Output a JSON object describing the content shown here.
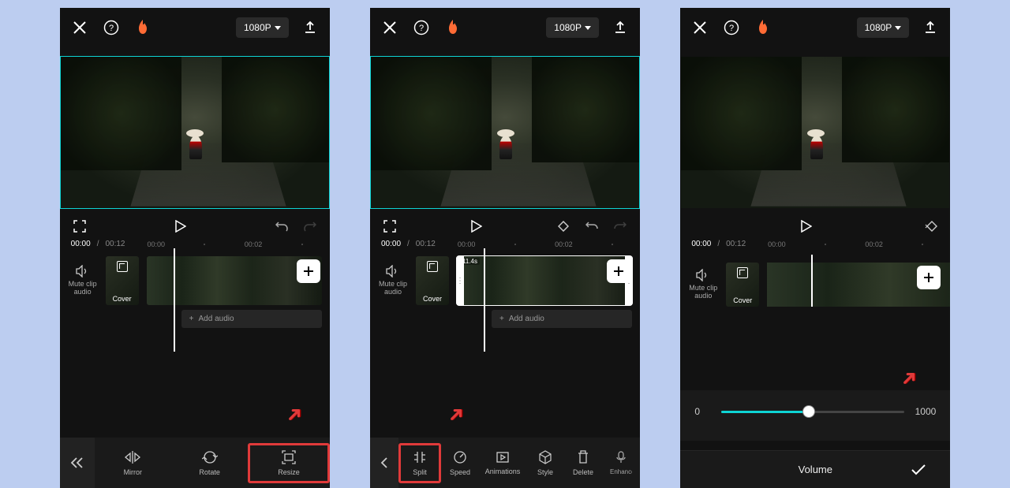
{
  "topbar": {
    "resolution": "1080P"
  },
  "playback": {
    "current": "00:00",
    "total": "00:12",
    "marks": [
      "00:00",
      "00:02"
    ]
  },
  "editor": {
    "mute_label": "Mute clip audio",
    "cover_label": "Cover",
    "add_audio": "Add audio",
    "clip_duration": "11.4s"
  },
  "tools_set1": {
    "mirror": "Mirror",
    "rotate": "Rotate",
    "resize": "Resize"
  },
  "tools_set2": {
    "split": "Split",
    "speed": "Speed",
    "animations": "Animations",
    "style": "Style",
    "delete": "Delete",
    "enhance": "Enhance voice"
  },
  "volume": {
    "min": "0",
    "max": "1000",
    "title": "Volume"
  }
}
